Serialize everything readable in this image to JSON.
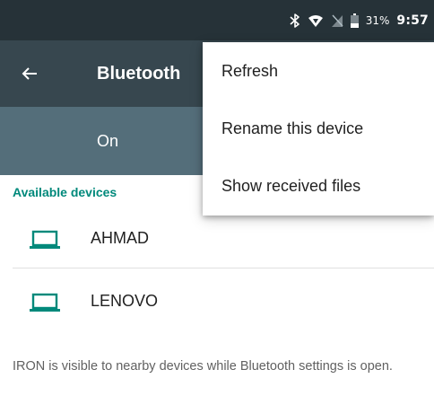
{
  "status_bar": {
    "icons": [
      "bluetooth-icon",
      "wifi-icon",
      "no-signal-icon",
      "battery-icon"
    ],
    "battery_percent": "31%",
    "time": "9:57"
  },
  "app_bar": {
    "back_icon": "arrow-back-icon",
    "title": "Bluetooth"
  },
  "switch_row": {
    "label": "On"
  },
  "devices": {
    "section_title": "Available devices",
    "items": [
      {
        "name": "AHMAD",
        "icon": "laptop-icon"
      },
      {
        "name": "LENOVO",
        "icon": "laptop-icon"
      }
    ]
  },
  "footer": {
    "note": "IRON is visible to nearby devices while Bluetooth settings is open."
  },
  "overflow_menu": {
    "items": [
      {
        "label": "Refresh"
      },
      {
        "label": "Rename this device"
      },
      {
        "label": "Show received files"
      }
    ]
  },
  "colors": {
    "status_bar": "#263238",
    "app_bar": "#37474f",
    "switch_row": "#546e7a",
    "accent": "#00897b"
  }
}
